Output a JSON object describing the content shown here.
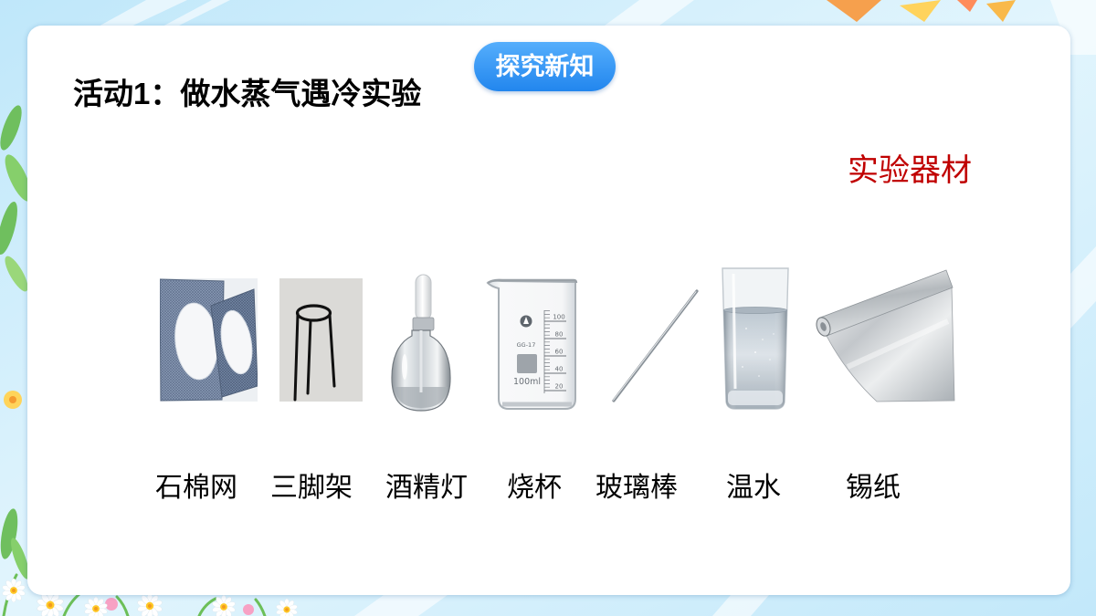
{
  "badge": {
    "label": "探究新知"
  },
  "title": "活动1：做水蒸气遇冷实验",
  "section_label": "实验器材",
  "materials": [
    {
      "label": "石棉网",
      "icon": "asbestos-gauze"
    },
    {
      "label": "三脚架",
      "icon": "tripod"
    },
    {
      "label": "酒精灯",
      "icon": "alcohol-lamp"
    },
    {
      "label": "烧杯",
      "icon": "beaker"
    },
    {
      "label": "玻璃棒",
      "icon": "glass-rod"
    },
    {
      "label": "温水",
      "icon": "warm-water-glass"
    },
    {
      "label": "锡纸",
      "icon": "tin-foil"
    }
  ],
  "beaker_markings": {
    "capacity": "100ml",
    "code": "GG-17",
    "scale": [
      "100",
      "80",
      "60",
      "40",
      "20"
    ]
  },
  "colors": {
    "badge": "#2286ee",
    "title": "#000000",
    "section_label": "#c00000",
    "card": "#ffffff"
  }
}
